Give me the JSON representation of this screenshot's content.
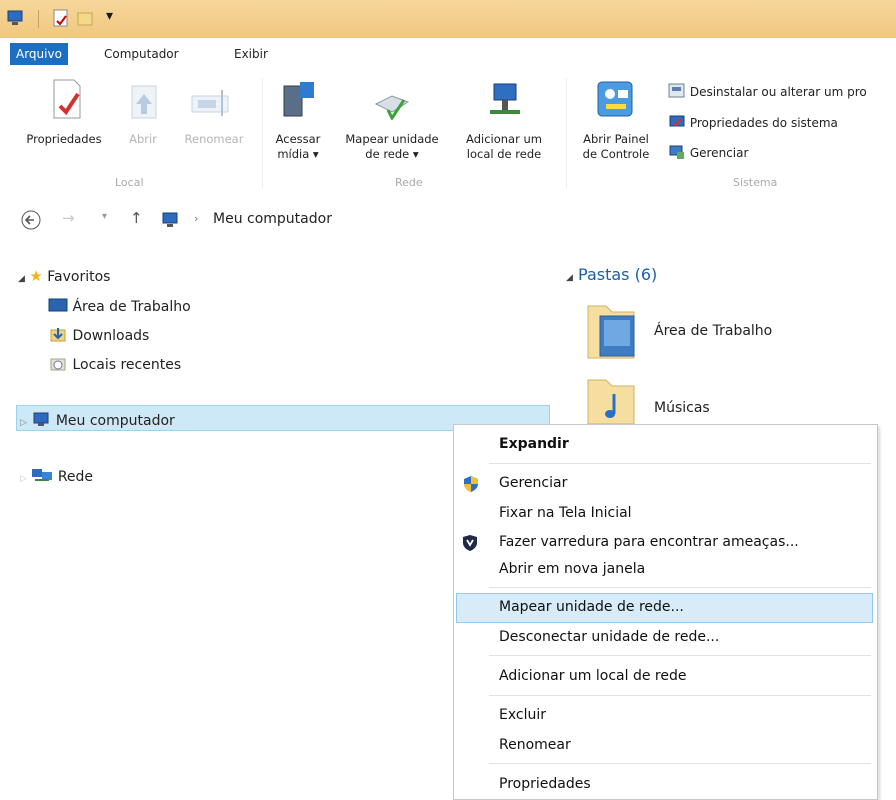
{
  "ribbon_tabs": [
    "Arquivo",
    "Computador",
    "Exibir"
  ],
  "ribbon": {
    "local": {
      "group_label": "Local",
      "propriedades": "Propriedades",
      "abrir": "Abrir",
      "renomear": "Renomear"
    },
    "rede": {
      "group_label": "Rede",
      "acessar_midia": [
        "Acessar",
        "mídia ▾"
      ],
      "mapear_unidade": [
        "Mapear unidade",
        "de rede ▾"
      ],
      "adicionar_local": [
        "Adicionar um",
        "local de rede"
      ]
    },
    "sistema": {
      "group_label": "Sistema",
      "abrir_painel": [
        "Abrir Painel",
        "de Controle"
      ],
      "desinstalar": "Desinstalar ou alterar um pro",
      "propriedades_sistema": "Propriedades do sistema",
      "gerenciar": "Gerenciar"
    }
  },
  "address": {
    "path": "Meu computador"
  },
  "nav": {
    "favoritos": "Favoritos",
    "area_trabalho": "Área de Trabalho",
    "downloads": "Downloads",
    "locais_recentes": "Locais recentes",
    "meu_computador": "Meu computador",
    "rede": "Rede"
  },
  "content": {
    "section": "Pastas (6)",
    "folders": [
      "Área de Trabalho",
      "Músicas"
    ]
  },
  "context_menu": {
    "expandir": "Expandir",
    "gerenciar": "Gerenciar",
    "fixar": "Fixar na Tela Inicial",
    "varredura": "Fazer varredura para encontrar ameaças...",
    "nova_janela": "Abrir em nova janela",
    "mapear": "Mapear unidade de rede...",
    "desconectar": "Desconectar unidade de rede...",
    "adicionar_local": "Adicionar um local de rede",
    "excluir": "Excluir",
    "renomear": "Renomear",
    "propriedades": "Propriedades"
  },
  "colors": {
    "title_bar": "#f0c780",
    "active_tab": "#1a6fc4",
    "selection": "#cde8f7",
    "section_header": "#1a5ea8"
  }
}
